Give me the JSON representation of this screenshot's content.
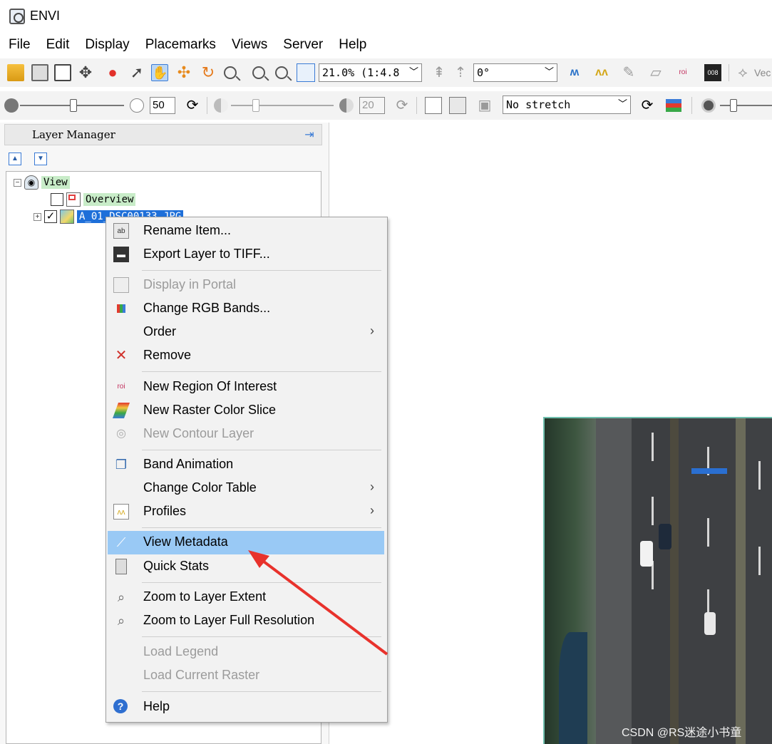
{
  "window": {
    "title": "ENVI"
  },
  "menubar": [
    "File",
    "Edit",
    "Display",
    "Placemarks",
    "Views",
    "Server",
    "Help"
  ],
  "toolbar1": {
    "zoom_value": "21.0% (1:4.8",
    "rotation_value": "0°",
    "vector_label": "Vec"
  },
  "toolbar2": {
    "brightness_value": "50",
    "transparency_value": "20",
    "stretch_value": "No stretch"
  },
  "layer_manager": {
    "title": "Layer Manager",
    "tree": {
      "view_label": "View",
      "overview_label": "Overview",
      "raster_label": "A_01_DSC00133.JPG"
    }
  },
  "context_menu": {
    "items": [
      {
        "label": "Rename Item...",
        "icon": "rename-icon",
        "enabled": true
      },
      {
        "label": "Export Layer to TIFF...",
        "icon": "save-icon",
        "enabled": true
      },
      {
        "label": "Display in Portal",
        "icon": "portal-icon",
        "enabled": false
      },
      {
        "label": "Change RGB Bands...",
        "icon": "rgb-icon",
        "enabled": true
      },
      {
        "label": "Order",
        "icon": "",
        "enabled": true,
        "submenu": true
      },
      {
        "label": "Remove",
        "icon": "remove-icon",
        "enabled": true
      },
      {
        "label": "New Region Of Interest",
        "icon": "roi-icon",
        "enabled": true
      },
      {
        "label": "New Raster Color Slice",
        "icon": "color-slice-icon",
        "enabled": true
      },
      {
        "label": "New Contour Layer",
        "icon": "contour-icon",
        "enabled": false
      },
      {
        "label": "Band Animation",
        "icon": "animation-icon",
        "enabled": true
      },
      {
        "label": "Change Color Table",
        "icon": "",
        "enabled": true,
        "submenu": true
      },
      {
        "label": "Profiles",
        "icon": "profiles-icon",
        "enabled": true,
        "submenu": true
      },
      {
        "label": "View Metadata",
        "icon": "metadata-icon",
        "enabled": true,
        "highlighted": true
      },
      {
        "label": "Quick Stats",
        "icon": "stats-icon",
        "enabled": true
      },
      {
        "label": "Zoom to Layer Extent",
        "icon": "zoom-extent-icon",
        "enabled": true
      },
      {
        "label": "Zoom to Layer Full Resolution",
        "icon": "zoom-full-icon",
        "enabled": true
      },
      {
        "label": "Load Legend",
        "icon": "",
        "enabled": false
      },
      {
        "label": "Load Current Raster",
        "icon": "",
        "enabled": false
      },
      {
        "label": "Help",
        "icon": "help-icon",
        "enabled": true
      }
    ]
  },
  "watermark": "CSDN @RS迷途小书童",
  "colors": {
    "highlight": "#99c9f5",
    "annotation_arrow": "#e8322c",
    "selection": "#1e6fd9"
  }
}
